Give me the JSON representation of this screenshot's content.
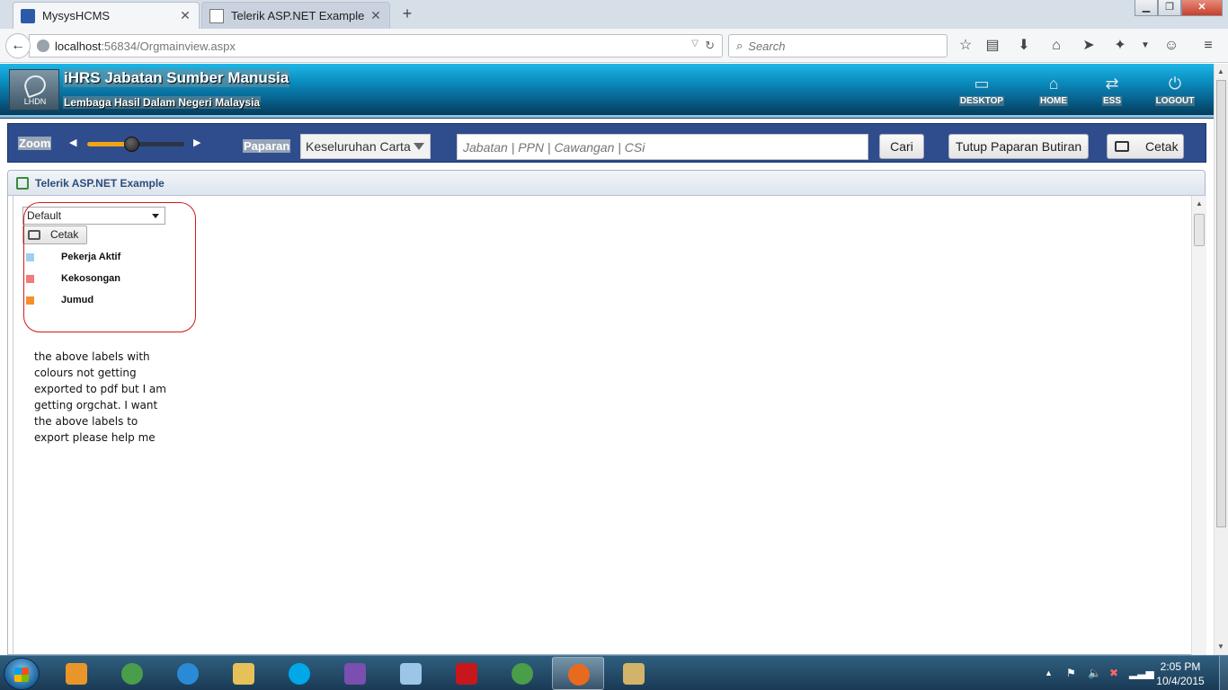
{
  "browser": {
    "tabs": [
      {
        "label": "MysysHCMS",
        "active": true
      },
      {
        "label": "Telerik ASP.NET Example",
        "active": false
      }
    ],
    "new_tab": "+",
    "url_host": "localhost",
    "url_path": ":56834/Orgmainview.aspx",
    "search_placeholder": "Search",
    "window_controls": {
      "minimize": "▁",
      "maximize": "❐",
      "close": "✕"
    }
  },
  "app": {
    "logo_text": "LHDN",
    "title": "iHRS Jabatan Sumber Manusia",
    "subtitle": "Lembaga Hasil Dalam Negeri Malaysia",
    "nav": [
      {
        "label": "DESKTOP",
        "icon": "monitor-icon"
      },
      {
        "label": "HOME",
        "icon": "home-icon"
      },
      {
        "label": "ESS",
        "icon": "shuffle-icon"
      },
      {
        "label": "LOGOUT",
        "icon": "power-icon"
      }
    ]
  },
  "toolbar": {
    "zoom_label": "Zoom",
    "zoom_level": 0.45,
    "paparan_label": "Paparan",
    "view_value": "Keseluruhan Carta",
    "search_placeholder": "Jabatan | PPN | Cawangan | CSi",
    "search_button": "Cari",
    "close_detail_button": "Tutup Paparan Butiran",
    "print_button": "Cetak"
  },
  "panel": {
    "title": "Telerik ASP.NET Example",
    "dropdown_value": "Default",
    "print_button": "Cetak",
    "legend": [
      {
        "label": "Pekerja Aktif",
        "color": "#9ccff2"
      },
      {
        "label": "Kekosongan",
        "color": "#ef7b7b"
      },
      {
        "label": "Jumud",
        "color": "#f5902c"
      }
    ],
    "note": "the above labels with colours not getting exported to pdf but I am getting orgchat. I want the above labels to export please help me"
  },
  "taskbar": {
    "time": "2:05 PM",
    "date": "10/4/2015",
    "apps": [
      {
        "name": "media-player",
        "color": "#e8962a"
      },
      {
        "name": "chrome",
        "color": "#4a9e4a"
      },
      {
        "name": "internet-explorer",
        "color": "#2a8ad8"
      },
      {
        "name": "file-explorer",
        "color": "#e6c15a"
      },
      {
        "name": "skype",
        "color": "#00a8e8"
      },
      {
        "name": "visual-studio",
        "color": "#7a4fb0"
      },
      {
        "name": "notepad",
        "color": "#9cc6e6"
      },
      {
        "name": "acrobat",
        "color": "#c8161d"
      },
      {
        "name": "chrome-2",
        "color": "#4a9e4a"
      },
      {
        "name": "firefox",
        "color": "#e86a1e"
      },
      {
        "name": "paint",
        "color": "#d2b36a"
      }
    ]
  }
}
